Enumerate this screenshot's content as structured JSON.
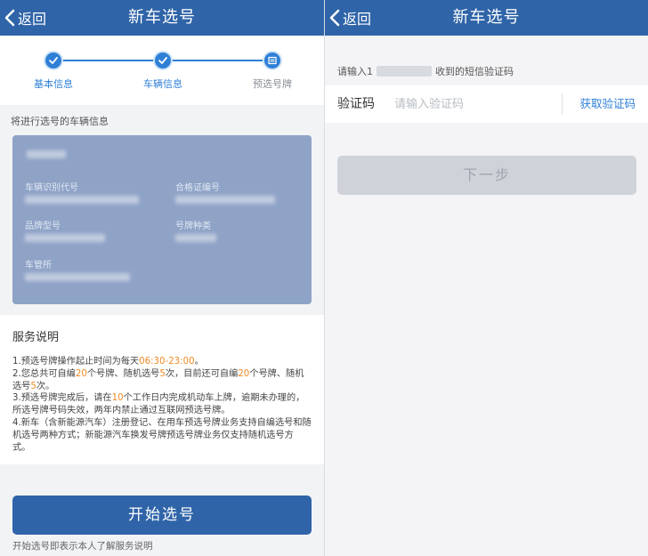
{
  "left_screen": {
    "nav": {
      "back_label": "返回",
      "title": "新车选号"
    },
    "stepper": {
      "steps": [
        {
          "label": "基本信息",
          "status": "done"
        },
        {
          "label": "车辆信息",
          "status": "done"
        },
        {
          "label": "预选号牌",
          "status": "current"
        }
      ]
    },
    "section_hint": "将进行选号的车辆信息",
    "vehicle_card": {
      "fields": {
        "vin_label": "车辆识别代号",
        "cert_label": "合格证编号",
        "model_label": "品牌型号",
        "plate_type_label": "号牌种类",
        "office_label": "车管所"
      }
    },
    "service": {
      "title": "服务说明",
      "line1_a": "1.预选号牌操作起止时间为每天",
      "line1_time": "06:30-23:00",
      "line1_b": "。",
      "line2_a": "2.您总共可自编",
      "line2_n1": "20",
      "line2_b": "个号牌、随机选号",
      "line2_n2": "5",
      "line2_c": "次，目前还可自编",
      "line2_n3": "20",
      "line2_d": "个号牌、随机选号",
      "line2_n4": "5",
      "line2_e": "次。",
      "line3_a": "3.预选号牌完成后，请在",
      "line3_n": "10",
      "line3_b": "个工作日内完成机动车上牌，逾期未办理的，所选号牌号码失效，两年内禁止通过互联网预选号牌。",
      "line4": "4.新车（含新能源汽车）注册登记、在用车预选号牌业务支持自编选号和随机选号两种方式；新能源汽车换发号牌预选号牌业务仅支持随机选号方式。"
    },
    "start_button": "开始选号",
    "start_note": "开始选号即表示本人了解服务说明"
  },
  "right_screen": {
    "nav": {
      "back_label": "返回",
      "title": "新车选号"
    },
    "sms_prompt_prefix": "请输入1",
    "sms_prompt_suffix": "收到的短信验证码",
    "code_label": "验证码",
    "code_placeholder": "请输入验证码",
    "get_code_label": "获取验证码",
    "next_button": "下一步"
  },
  "colors": {
    "nav_blue": "#2f64a8",
    "accent_blue": "#2e7fd6",
    "highlight_orange": "#f08a24",
    "card_bg": "#8fa3c7",
    "disabled_button": "#cfd3d9"
  },
  "icons": [
    "chevron-left-icon",
    "check-icon",
    "plate-icon"
  ]
}
